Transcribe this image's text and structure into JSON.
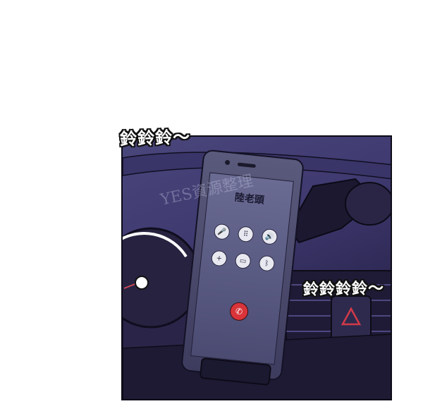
{
  "sfx": {
    "top": "鈴鈴鈴～",
    "right": "鈴鈴鈴鈴～"
  },
  "phone": {
    "caller_name": "陸老頭",
    "buttons": [
      {
        "icon": "microphone-icon",
        "glyph": "🎤"
      },
      {
        "icon": "keypad-icon",
        "glyph": "⠿"
      },
      {
        "icon": "speaker-icon",
        "glyph": "🔊"
      },
      {
        "icon": "add-call-icon",
        "glyph": "+"
      },
      {
        "icon": "video-icon",
        "glyph": "▭"
      },
      {
        "icon": "bluetooth-icon",
        "glyph": "ᛒ"
      }
    ],
    "end_call_icon": "end-call-icon",
    "end_call_glyph": "✆",
    "end_call_color": "#d8343a"
  },
  "watermark": "YES資源整理",
  "colors": {
    "panel_dark": "#1f1b3b",
    "panel_light": "#4a477c",
    "outline": "#0d0b17"
  }
}
